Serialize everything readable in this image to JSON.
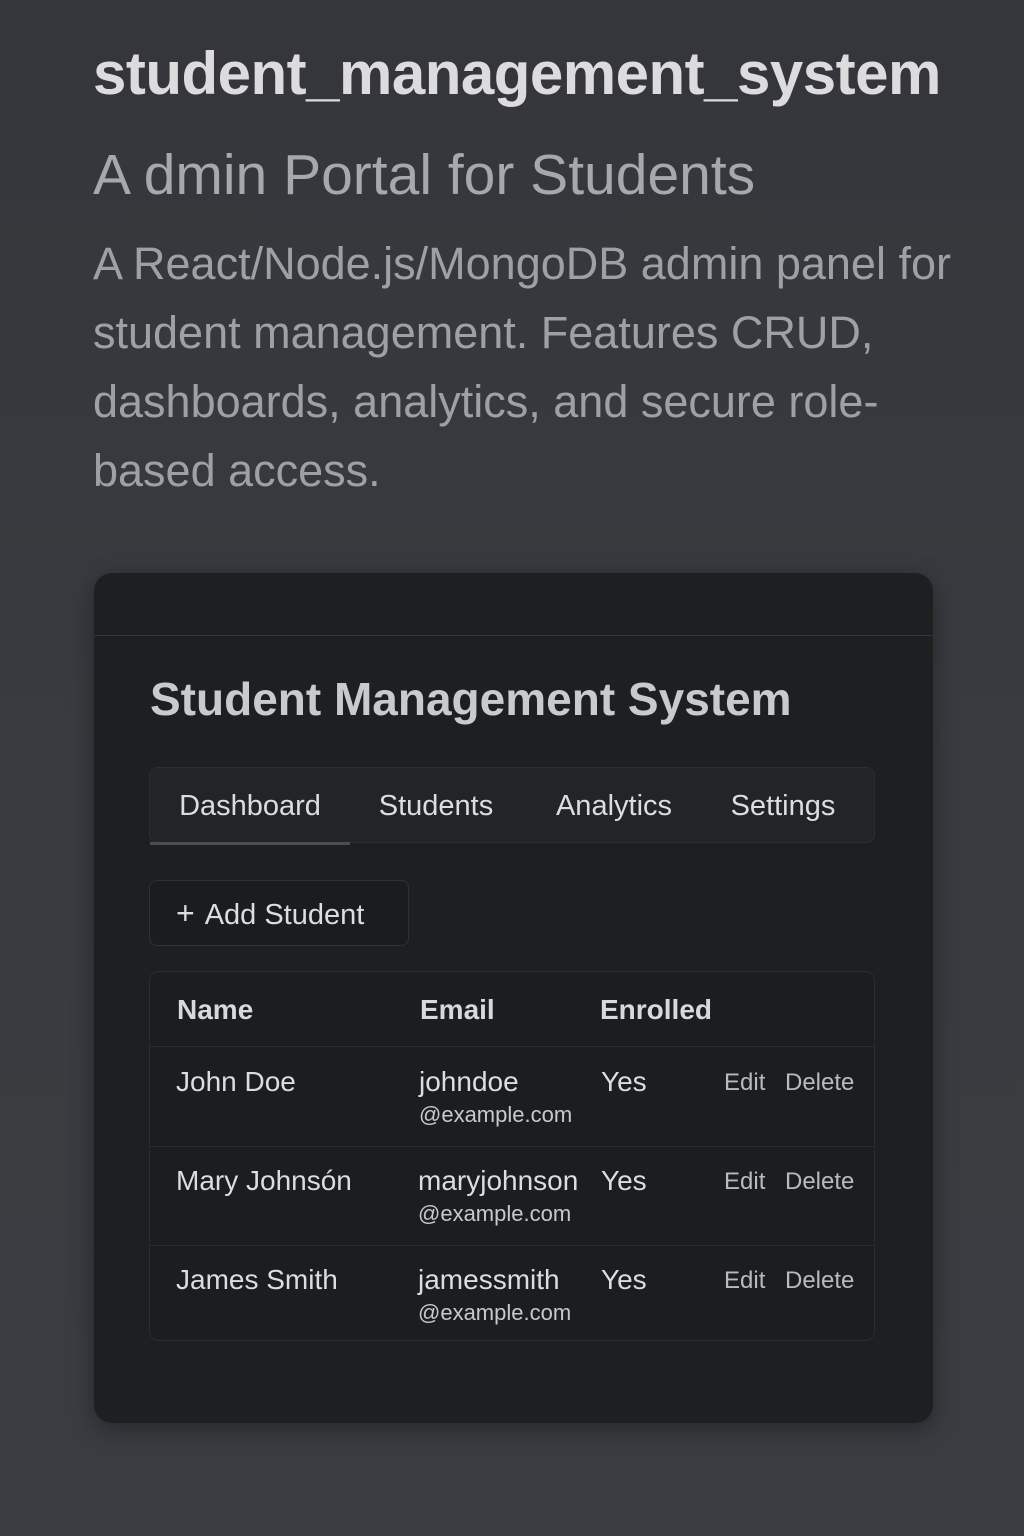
{
  "repo": {
    "title": "student_management_system",
    "subtitle": "A dmin Portal for Students",
    "description": "A React/Node.js/MongoDB admin panel for student management. Features CRUD, dashboards, analytics, and secure role-based access."
  },
  "app": {
    "title": "Student Management System",
    "tabs": [
      {
        "label": "Dashboard",
        "active": true
      },
      {
        "label": "Students",
        "active": false
      },
      {
        "label": "Analytics",
        "active": false
      },
      {
        "label": "Settings",
        "active": false
      }
    ],
    "add_button": {
      "icon": "plus-icon",
      "label": "Add Student"
    },
    "table": {
      "headers": [
        "Name",
        "Email",
        "Enrolled"
      ],
      "rows": [
        {
          "name": "John Doe",
          "email_user": "johndoe",
          "email_domain": "@example.com",
          "enrolled": "Yes",
          "edit": "Edit",
          "delete": "Delete"
        },
        {
          "name": "Mary Johnsón",
          "email_user": "maryjohnson",
          "email_domain": "@example.com",
          "enrolled": "Yes",
          "edit": "Edit",
          "delete": "Delete"
        },
        {
          "name": "James Smith",
          "email_user": "jamessmith",
          "email_domain": "@example.com",
          "enrolled": "Yes",
          "edit": "Edit",
          "delete": "Delete"
        }
      ]
    }
  },
  "colors": {
    "page_background": "#393b40",
    "panel_background": "#1e1f21",
    "text_primary": "#dcdde0",
    "text_muted": "#a6a8ad"
  }
}
